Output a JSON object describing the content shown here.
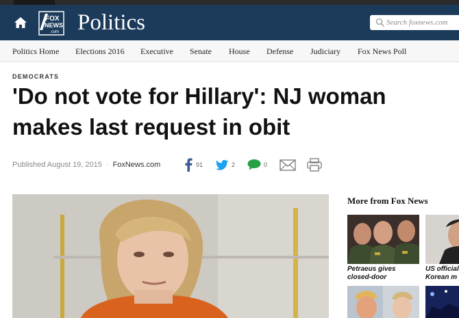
{
  "header": {
    "section_title": "Politics",
    "search_placeholder": "Search foxnews.com",
    "logo_text_top": "FOX",
    "logo_text_mid": "NEWS",
    "logo_text_bottom": ".com"
  },
  "subnav": {
    "items": [
      "Politics Home",
      "Elections 2016",
      "Executive",
      "Senate",
      "House",
      "Defense",
      "Judiciary",
      "Fox News Poll"
    ]
  },
  "article": {
    "category": "DEMOCRATS",
    "headline_line1": "'Do not vote for Hillary': NJ woman",
    "headline_line2": "makes last request in obit",
    "published": "Published August 19, 2015",
    "source": "FoxNews.com",
    "social": {
      "facebook_count": "91",
      "twitter_count": "2",
      "comments_count": "0"
    }
  },
  "sidebar": {
    "title": "More from Fox News",
    "items": [
      {
        "caption_line1": "Petraeus gives",
        "caption_line2": "closed-door"
      },
      {
        "caption_line1": "US official",
        "caption_line2": "Korean m"
      }
    ]
  },
  "colors": {
    "header_bg": "#1c3b5a",
    "facebook": "#3b5998",
    "twitter": "#1da1f2",
    "comment": "#27a046"
  },
  "icons": [
    "home-icon",
    "fox-news-logo",
    "search-icon",
    "facebook-icon",
    "twitter-icon",
    "comment-icon",
    "email-icon",
    "print-icon"
  ]
}
